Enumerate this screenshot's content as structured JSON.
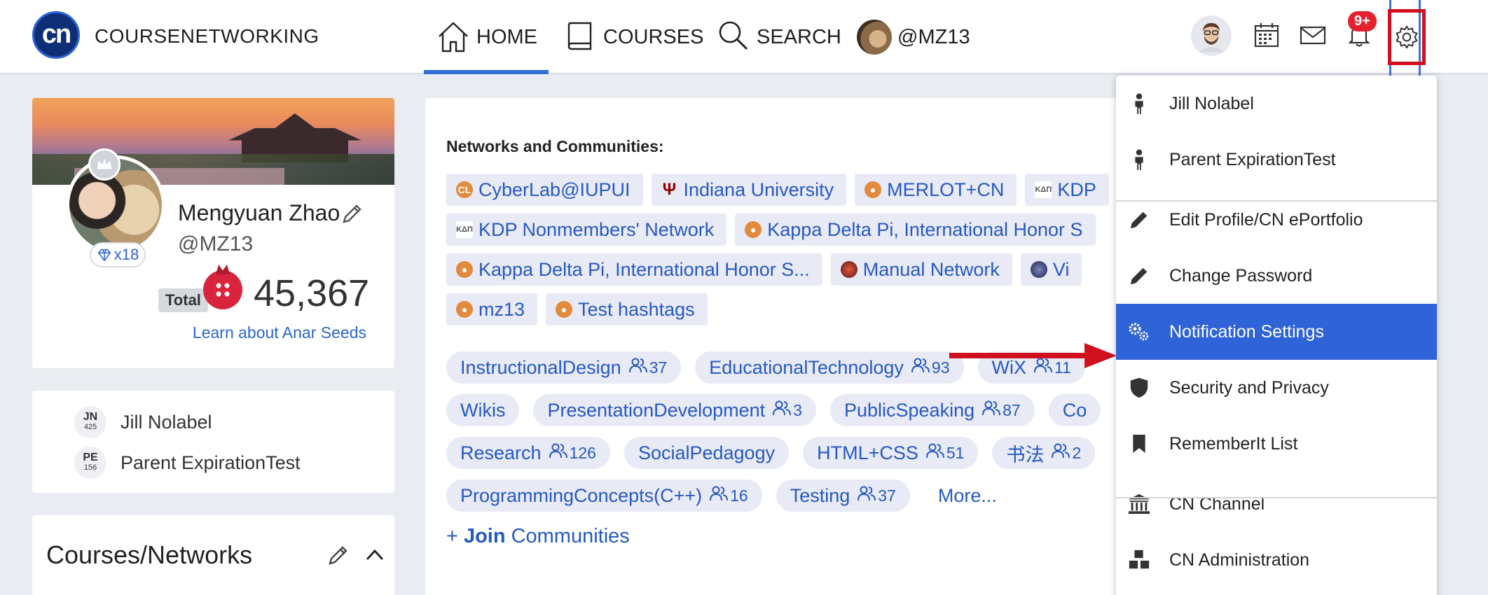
{
  "app": {
    "brand": "COURSENETWORKING",
    "logo_text": "cn"
  },
  "nav": {
    "home": "HOME",
    "courses": "COURSES",
    "search": "SEARCH",
    "user": "@MZ13",
    "notification_count": "9+"
  },
  "profile": {
    "name": "Mengyuan Zhao",
    "handle": "@MZ13",
    "diamonds": "x18",
    "total_label": "Total",
    "score": "45,367",
    "learn_link": "Learn about Anar Seeds"
  },
  "children": [
    {
      "initials": "JN",
      "code": "425",
      "name": "Jill Nolabel"
    },
    {
      "initials": "PE",
      "code": "156",
      "name": "Parent ExpirationTest"
    }
  ],
  "courses_section": {
    "title": "Courses/Networks"
  },
  "networks": {
    "title": "Networks and Communities:",
    "rows": [
      [
        {
          "icon": "cl",
          "glyph": "CL",
          "label": "CyberLab@IUPUI"
        },
        {
          "icon": "iu",
          "glyph": "Ψ",
          "label": "Indiana University"
        },
        {
          "icon": "group",
          "glyph": "●",
          "label": "MERLOT+CN"
        },
        {
          "icon": "kdp",
          "glyph": "KΔΠ",
          "label": "KDP"
        }
      ],
      [
        {
          "icon": "kdp",
          "glyph": "KΔΠ",
          "label": "KDP Nonmembers' Network"
        },
        {
          "icon": "group",
          "glyph": "●",
          "label": "Kappa Delta Pi, International Honor S"
        }
      ],
      [
        {
          "icon": "group",
          "glyph": "●",
          "label": "Kappa Delta Pi, International Honor S..."
        },
        {
          "icon": "dark",
          "glyph": "",
          "label": "Manual Network"
        },
        {
          "icon": "globe",
          "glyph": "",
          "label": "Vi"
        }
      ],
      [
        {
          "icon": "group",
          "glyph": "●",
          "label": "mz13"
        },
        {
          "icon": "group",
          "glyph": "●",
          "label": "Test hashtags"
        }
      ]
    ]
  },
  "tags": {
    "rows": [
      [
        {
          "label": "InstructionalDesign",
          "count": "37"
        },
        {
          "label": "EducationalTechnology",
          "count": "93"
        },
        {
          "label": "WiX",
          "count": "11"
        }
      ],
      [
        {
          "label": "Wikis",
          "count": ""
        },
        {
          "label": "PresentationDevelopment",
          "count": "3"
        },
        {
          "label": "PublicSpeaking",
          "count": "87"
        },
        {
          "label": "Co",
          "count": ""
        }
      ],
      [
        {
          "label": "Research",
          "count": "126"
        },
        {
          "label": "SocialPedagogy",
          "count": ""
        },
        {
          "label": "HTML+CSS",
          "count": "51"
        },
        {
          "label": "书法",
          "count": "2"
        }
      ],
      [
        {
          "label": "ProgrammingConcepts(C++)",
          "count": "16"
        },
        {
          "label": "Testing",
          "count": "37"
        }
      ]
    ],
    "more": "More...",
    "join_plus": "+",
    "join_bold": "Join",
    "join_rest": "Communities"
  },
  "dropdown": {
    "items": [
      {
        "icon": "person-icon",
        "label": "Jill Nolabel"
      },
      {
        "icon": "person-icon",
        "label": "Parent ExpirationTest"
      },
      {
        "icon": "pencil-icon",
        "label": "Edit Profile/CN ePortfolio"
      },
      {
        "icon": "pencil-icon",
        "label": "Change Password"
      },
      {
        "icon": "gears-icon",
        "label": "Notification Settings",
        "active": true
      },
      {
        "icon": "shield-icon",
        "label": "Security and Privacy"
      },
      {
        "icon": "bookmark-icon",
        "label": "RememberIt List"
      },
      {
        "icon": "bank-icon",
        "label": "CN Channel"
      },
      {
        "icon": "cubes-icon",
        "label": "CN Administration"
      }
    ]
  },
  "colors": {
    "accent": "#2f63d8",
    "highlight_red": "#d0101e",
    "chip_bg": "#e8eaf6",
    "link": "#2659c4"
  }
}
